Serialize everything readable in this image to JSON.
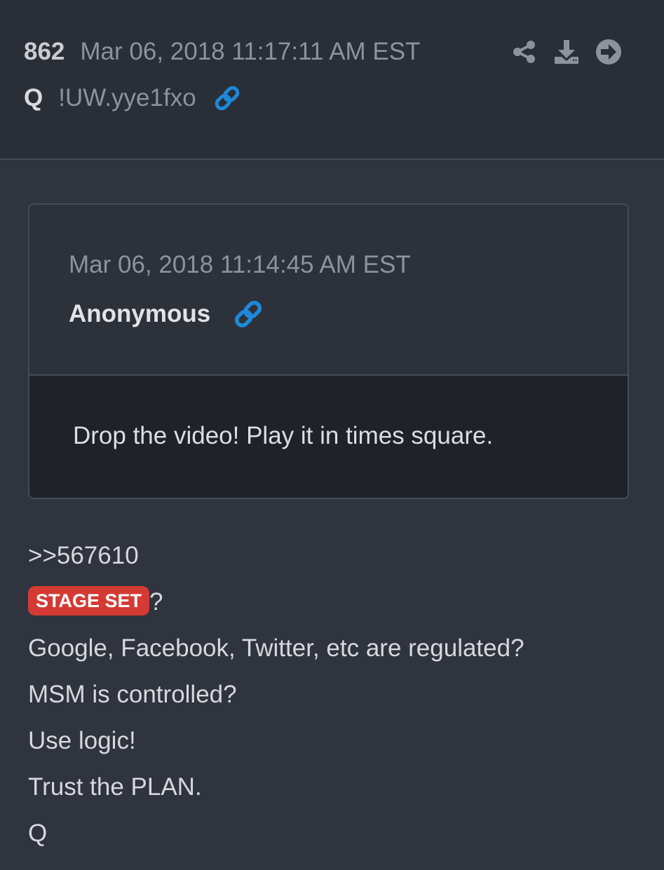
{
  "header": {
    "post_number": "862",
    "date": "Mar 06, 2018 11:17:11 AM EST",
    "author": "Q",
    "tripcode": "!UW.yye1fxo",
    "actions": [
      {
        "icon": "share-icon"
      },
      {
        "icon": "download-icon"
      },
      {
        "icon": "arrow-right-circle-icon"
      }
    ]
  },
  "quote": {
    "date": "Mar 06, 2018 11:14:45 AM EST",
    "author": "Anonymous",
    "text": "Drop the video! Play it in times square."
  },
  "post": {
    "reply_ref": ">>567610",
    "badge": "STAGE SET",
    "badge_suffix": "?",
    "lines": [
      "Google, Facebook, Twitter, etc are regulated?",
      "MSM is controlled?",
      "Use logic!",
      "Trust the PLAN.",
      "Q"
    ]
  },
  "colors": {
    "background": "#2f343e",
    "header_bg": "#2a2e37",
    "link_blue": "#1e88d8",
    "badge_red": "#d43a33",
    "quote_body_bg": "#1f2229"
  }
}
